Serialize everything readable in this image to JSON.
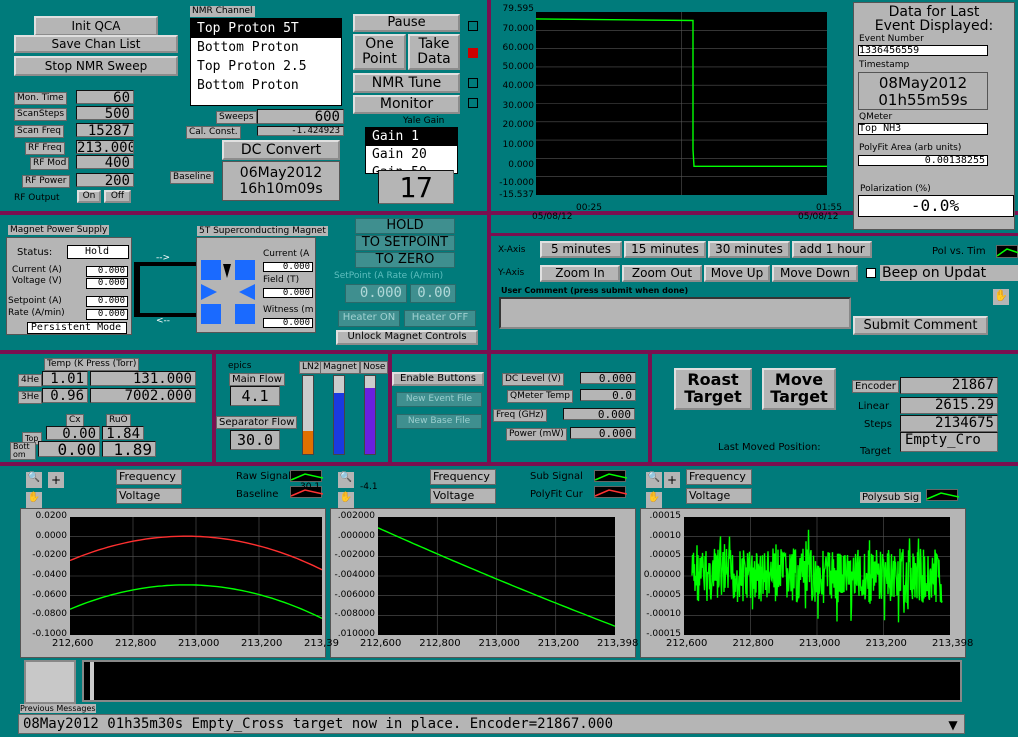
{
  "top_left": {
    "init_qca": "Init QCA",
    "save_chan": "Save Chan List",
    "stop_sweep": "Stop NMR Sweep"
  },
  "params": [
    {
      "label": "Mon. Time",
      "value": "60"
    },
    {
      "label": "ScanSteps",
      "value": "500"
    },
    {
      "label": "Scan Freq",
      "value": "15287"
    },
    {
      "label": "RF Freq",
      "value": "213.000"
    },
    {
      "label": "RF Mod",
      "value": "400"
    },
    {
      "label": "RF Power",
      "value": "200"
    }
  ],
  "rf_output": {
    "label": "RF Output",
    "on": "On",
    "off": "Off"
  },
  "nmr_channel": {
    "title": "NMR Channel",
    "items": [
      "Top Proton 5T",
      "Bottom Proton",
      "Top Proton 2.5",
      "Bottom Proton"
    ]
  },
  "sweeps": {
    "label": "Sweeps",
    "value": "600"
  },
  "cal_const": {
    "label": "Cal. Const.",
    "value": "-1.424923"
  },
  "dc_convert": "DC Convert",
  "baseline": {
    "label": "Baseline",
    "date": "06May2012",
    "time": "16h10m09s"
  },
  "buttons_mid": {
    "pause": "Pause",
    "one_point": "One Point",
    "take_data": "Take Data",
    "nmr_tune": "NMR Tune",
    "monitor": "Monitor"
  },
  "yale_gain": {
    "title": "Yale Gain",
    "items": [
      "Gain 1",
      "Gain 20",
      "Gain 50"
    ],
    "value": "17"
  },
  "top_chart": {
    "ticks_y": [
      "79.595",
      "70.000",
      "60.000",
      "50.000",
      "40.000",
      "30.000",
      "20.000",
      "10.000",
      "0.000",
      "-10.000",
      "-15.537"
    ],
    "ticks_x": [
      {
        "t": "00:25",
        "d": "05/08/12"
      },
      {
        "t": "01:55",
        "d": "05/08/12"
      }
    ],
    "chart_data": {
      "type": "line",
      "ylim": [
        -15.537,
        79.595
      ],
      "series": [
        {
          "values": [
            76,
            76,
            75.5,
            75,
            -0.5,
            -0.5,
            -0.5,
            -0.5
          ]
        }
      ]
    }
  },
  "event": {
    "title1": "Data for Last",
    "title2": "Event Displayed:",
    "event_num_label": "Event Number",
    "event_num": "1336456559",
    "timestamp_label": "Timestamp",
    "date": "08May2012",
    "time": "01h55m59s",
    "qmeter_label": "QMeter",
    "qmeter": "Top NH3",
    "polyfit_label": "PolyFit Area (arb units)",
    "polyfit": "0.00138255",
    "pol_label": "Polarization (%)",
    "pol": "-0.0%"
  },
  "xaxis": {
    "label": "X-Axis",
    "b1": "5 minutes",
    "b2": "15 minutes",
    "b3": "30 minutes",
    "b4": "add 1 hour"
  },
  "yaxis": {
    "label": "Y-Axis",
    "b1": "Zoom In",
    "b2": "Zoom Out",
    "b3": "Move Up",
    "b4": "Move Down"
  },
  "pol_vs_time": "Pol vs. Tim",
  "beep": "Beep on Updat",
  "comment": {
    "label": "User Comment (press submit when done)",
    "submit": "Submit Comment"
  },
  "magnet_supply": {
    "title": "Magnet Power Supply",
    "status_label": "Status:",
    "status": "Hold",
    "current_label": "Current (A)",
    "current": "0.000",
    "voltage_label": "Voltage (V)",
    "voltage": "0.000",
    "setpoint_label": "Setpoint (A)",
    "setpoint": "0.000",
    "rate_label": "Rate (A/min)",
    "rate": "0.000",
    "persistent": "Persistent Mode"
  },
  "supercond": {
    "title": "5T Superconducting Magnet",
    "current_label": "Current (A",
    "current": "0.000",
    "field_label": "Field (T)",
    "field": "0.000",
    "witness_label": "Witness (m",
    "witness": "0.000"
  },
  "hold": {
    "l1": "HOLD",
    "l2": "TO SETPOINT",
    "l3": "TO ZERO",
    "setpoint_label": "SetPoint (A Rate (A/min)",
    "sp": "0.000",
    "rate": "0.00",
    "heater_on": "Heater ON",
    "heater_off": "Heater OFF",
    "unlock": "Unlock Magnet Controls"
  },
  "temp": {
    "title": "Temp (K Press (Torr)",
    "he4_label": "4He",
    "he4_t": "1.01",
    "he4_p": "131.000",
    "he3_label": "3He",
    "he3_t": "0.96",
    "he3_p": "7002.000",
    "cx_label": "Cx",
    "ruo_label": "RuO",
    "top_label": "Top",
    "top_cx": "0.00",
    "top_ruo": "1.84",
    "bott_label": "Bott om",
    "bott_cx": "0.00",
    "bott_ruo": "1.89"
  },
  "epics": {
    "label": "epics",
    "main_flow_label": "Main Flow",
    "main_flow": "4.1",
    "sep_flow_label": "Separator Flow",
    "sep_flow": "30.0",
    "ln2": "LN2",
    "magnet": "Magnet",
    "nose": "Nose",
    "ln2_level": 0.3,
    "magnet_level": 0.78,
    "nose_level": 0.85
  },
  "enable": {
    "enable": "Enable Buttons",
    "new_event": "New Event File",
    "new_base": "New Base File"
  },
  "dc_level": {
    "label": "DC Level (V)",
    "value": "0.000",
    "qtemp_label": "QMeter Temp",
    "qtemp": "0.0",
    "freq_label": "Freq (GHz)",
    "freq": "0.000",
    "power_label": "Power (mW)",
    "power": "0.000"
  },
  "target": {
    "roast": "Roast Target",
    "move": "Move Target",
    "last_moved": "Last Moved Position:",
    "encoder_label": "Encoder",
    "encoder": "21867",
    "linear_label": "Linear",
    "linear": "2615.29",
    "steps_label": "Steps",
    "steps": "2134675",
    "target_label": "Target",
    "target": "Empty_Cro"
  },
  "sig1": {
    "freq": "Frequency",
    "volt": "Voltage",
    "raw": "Raw Signal",
    "baseline": "Baseline"
  },
  "sig2": {
    "freq": "Frequency",
    "volt": "Voltage",
    "sub": "Sub Signal",
    "polyfit": "PolyFit Cur"
  },
  "sig3": {
    "freq": "Frequency",
    "volt": "Voltage",
    "polysub": "Polysub Sig"
  },
  "chart1": {
    "yt": [
      "0.0200",
      "0.0000",
      "-0.0200",
      "-0.0400",
      "-0.0600",
      "-0.0800",
      "-0.1000"
    ],
    "xt": [
      "212,600",
      "212,800",
      "213,000",
      "213,200",
      "213,39"
    ],
    "chart_data": {
      "type": "line",
      "ylim": [
        -0.1,
        0.02
      ],
      "series": [
        {
          "name": "Raw Signal",
          "color": "#00ff00"
        },
        {
          "name": "Baseline",
          "color": "#ff3030"
        }
      ]
    }
  },
  "chart2": {
    "yt": [
      ".002000",
      ".000000",
      "-.002000",
      "-.004000",
      "-.006000",
      "-.008000",
      ".010000"
    ],
    "xt": [
      "212,600",
      "212,800",
      "213,000",
      "213,200",
      "213,398"
    ],
    "chart_data": {
      "type": "line",
      "ylim": [
        -0.01,
        0.002
      ],
      "series": [
        {
          "name": "Sub Signal",
          "color": "#00ff00"
        }
      ]
    }
  },
  "chart3": {
    "yt": [
      ".00015",
      ".00010",
      ".00005",
      "0.00000",
      "-.00005",
      "-.00010",
      "-.00015"
    ],
    "xt": [
      "212,600",
      "212,800",
      "213,000",
      "213,200",
      "213,398"
    ],
    "chart_data": {
      "type": "line",
      "ylim": [
        -0.00015,
        0.00015
      ],
      "series": [
        {
          "name": "Polysub Sig",
          "color": "#00ff00"
        }
      ]
    }
  },
  "misc": {
    "coord1": "30.1",
    "coord2": "-4.1"
  },
  "prev_messages": "Previous Messages",
  "status_msg": "08May2012 01h35m30s Empty_Cross target now in place.  Encoder=21867.000",
  "colors": {
    "teal": "#007b7b",
    "sep": "#7a1050",
    "grey": "#b5b5b5",
    "green": "#00ff00",
    "red": "#ff3030"
  }
}
